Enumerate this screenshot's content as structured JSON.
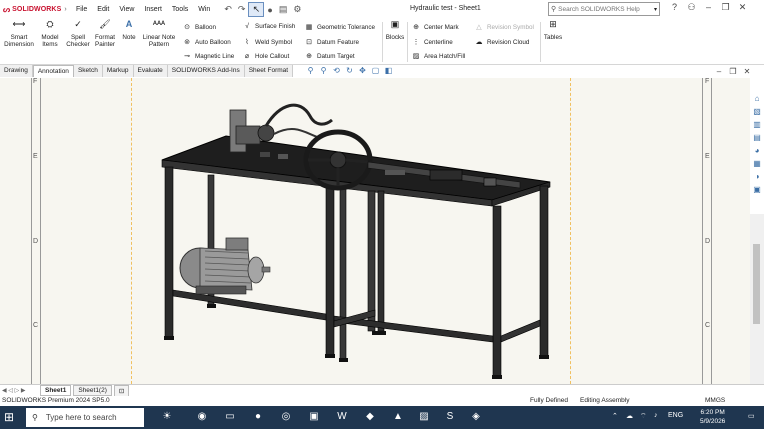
{
  "app": {
    "logo": "SOLIDWORKS",
    "document_title": "Hydraulic test - Sheet1",
    "menu": [
      "File",
      "Edit",
      "View",
      "Insert",
      "Tools",
      "Win"
    ],
    "search_placeholder": "Search SOLIDWORKS Help"
  },
  "ribbon": {
    "smart_dimension": [
      "Smart",
      "Dimension"
    ],
    "model_items": [
      "Model",
      "Items"
    ],
    "spell_checker": [
      "Spell",
      "Checker"
    ],
    "format_painter": [
      "Format",
      "Painter"
    ],
    "note": "Note",
    "linear_note_pattern": [
      "Linear Note",
      "Pattern"
    ],
    "col1": [
      "Balloon",
      "Auto Balloon",
      "Magnetic Line"
    ],
    "col2": [
      "Surface Finish",
      "Weld Symbol",
      "Hole Callout"
    ],
    "col3": [
      "Geometric Tolerance",
      "Datum Feature",
      "Datum Target"
    ],
    "blocks": "Blocks",
    "col4": [
      "Center Mark",
      "Centerline",
      "Area Hatch/Fill"
    ],
    "col5": [
      "Revision Symbol",
      "Revision Cloud"
    ],
    "tables": "Tables"
  },
  "tabs": [
    "Drawing",
    "Annotation",
    "Sketch",
    "Markup",
    "Evaluate",
    "SOLIDWORKS Add-Ins",
    "Sheet Format"
  ],
  "active_tab": "Annotation",
  "zones": [
    "F",
    "E",
    "D",
    "C"
  ],
  "sheet_tabs": [
    "Sheet1",
    "Sheet1(2)"
  ],
  "status": {
    "version": "SOLIDWORKS Premium 2024 SP5.0",
    "defined": "Fully Defined",
    "mode": "Editing Assembly",
    "units": "MMGS"
  },
  "taskbar": {
    "search_placeholder": "Type here to search",
    "lang": "ENG",
    "time": "6:20 PM",
    "date": "5/9/2026"
  },
  "colors": {
    "brand": "#c8102e",
    "taskbar": "#1f3650",
    "sheet": "#f7f6f0"
  }
}
